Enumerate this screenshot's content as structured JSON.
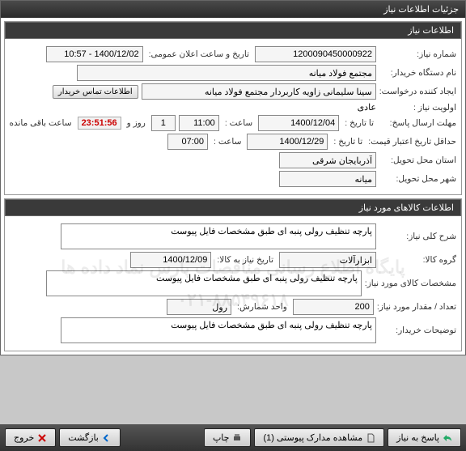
{
  "titlebar": "جزئیات اطلاعات نیاز",
  "section1_header": "اطلاعات نیاز",
  "section2_header": "اطلاعات کالاهای مورد نیاز",
  "labels": {
    "need_no": "شماره نیاز:",
    "buyer_dept": "نام دستگاه خریدار:",
    "requester": "ایجاد کننده درخواست:",
    "priority": "اولویت نیاز :",
    "reply_deadline": "مهلت ارسال پاسخ:",
    "to_date": "تا تاریخ :",
    "until_date2": "تا تاریخ :",
    "time": "ساعت :",
    "credit_deadline": "حداقل تاریخ اعتبار قیمت:",
    "delivery_state": "استان محل تحویل:",
    "delivery_city": "شهر محل تحویل:",
    "announce_dt": "تاریخ و ساعت اعلان عمومی:",
    "contact_btn": "اطلاعات تماس خریدار",
    "day_and": "روز و",
    "remaining": "ساعت باقی مانده",
    "general_desc": "شرح کلی نیاز:",
    "goods_group": "گروه کالا:",
    "need_date_goods": "تاریخ نیاز به کالا:",
    "goods_spec": "مشخصات کالای مورد نیاز:",
    "qty": "تعداد / مقدار مورد نیاز:",
    "unit": "واحد شمارش:",
    "buyer_notes": "توضیحات خریدار:"
  },
  "values": {
    "need_no": "1200090450000922",
    "buyer_dept": "مجتمع فولاد میانه",
    "requester": "سینا سلیمانی زاویه کاربردار مجتمع فولاد میانه",
    "priority": "عادی",
    "reply_date": "1400/12/04",
    "reply_time": "11:00",
    "credit_date": "1400/12/29",
    "credit_time": "07:00",
    "delivery_state": "آذربایجان شرقی",
    "delivery_city": "میانه",
    "announce_dt": "1400/12/02 - 10:57",
    "days_left": "1",
    "time_left": "23:51:56",
    "general_desc": "پارچه تنظیف رولی پنبه ای طبق مشخصات فایل پیوست",
    "goods_group": "ابزارآلات",
    "need_date_goods": "1400/12/09",
    "goods_spec": "پارچه تنظیف رولی پنبه ای طبق مشخصات فایل پیوست",
    "qty": "200",
    "unit": "رول",
    "buyer_notes": "پارچه تنظیف رولی پنبه ای طبق مشخصات فایل پیوست"
  },
  "footer": {
    "reply": "پاسخ به نیاز",
    "attachments": "مشاهده مدارک پیوستی (1)",
    "print": "چاپ",
    "back": "بازگشت",
    "exit": "خروج"
  },
  "watermark": {
    "line1": "پایگاه اطلاع رسانی مناقصات پارس نماد داده ها",
    "line2": "۰۲۱-۸۸۵۴۹۶۱۸"
  }
}
